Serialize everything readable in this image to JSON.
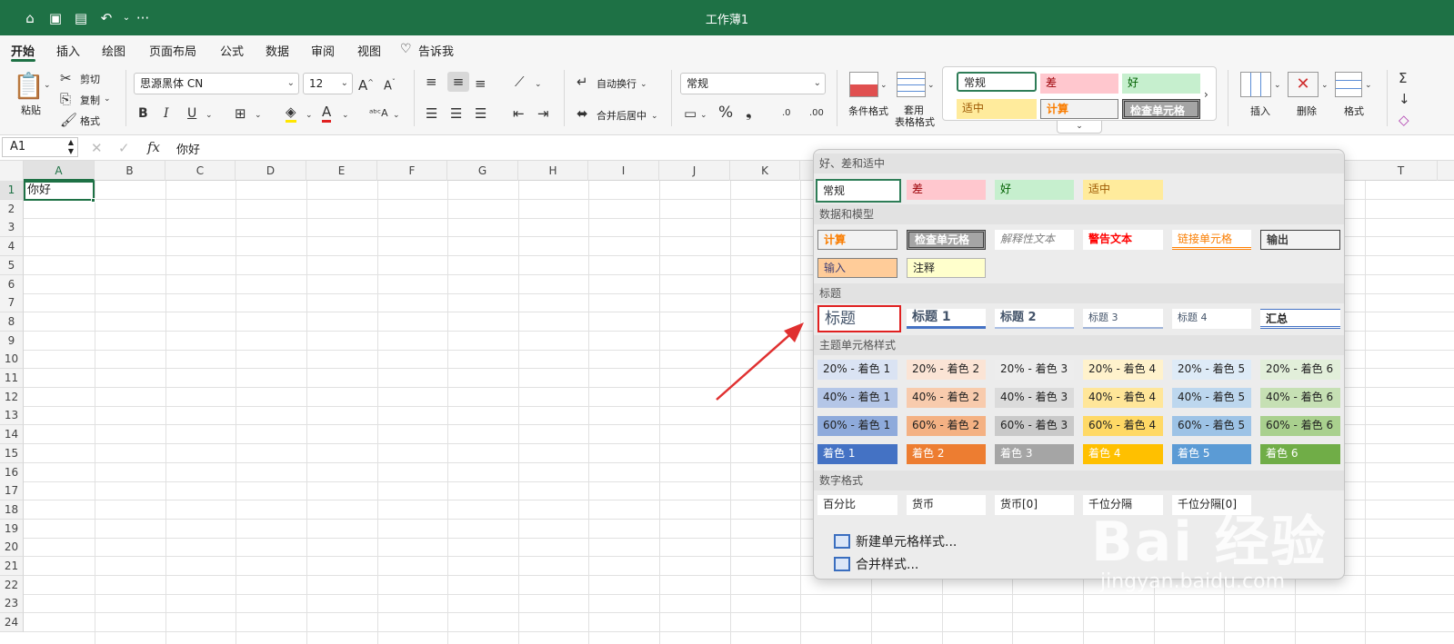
{
  "window": {
    "title": "工作薄1"
  },
  "qat": {
    "home_icon": "home-icon",
    "save_icon": "save-icon",
    "saveas_icon": "save-as-icon",
    "undo_icon": "undo-icon",
    "more": "···"
  },
  "tabs": [
    "开始",
    "插入",
    "绘图",
    "页面布局",
    "公式",
    "数据",
    "审阅",
    "视图",
    "告诉我"
  ],
  "ribbon": {
    "paste": "粘贴",
    "cut": "剪切",
    "copy": "复制",
    "format_painter": "格式",
    "font_name": "思源黑体 CN",
    "font_size": "12",
    "wrap_text": "自动换行",
    "merge_center": "合并后居中",
    "number_format": "常规",
    "cond_format": "条件格式",
    "table_format_1": "套用",
    "table_format_2": "表格格式",
    "styles": {
      "normal": "常规",
      "bad": "差",
      "good": "好",
      "neutral": "适中",
      "calc": "计算",
      "check": "检查单元格"
    },
    "insert": "插入",
    "delete": "删除",
    "format": "格式",
    "bold": "B",
    "italic": "I",
    "underline": "U",
    "percent": "%",
    "comma": "❟"
  },
  "formula": {
    "namebox": "A1",
    "fx": "fx",
    "value": "你好"
  },
  "grid": {
    "columns": [
      "A",
      "B",
      "C",
      "D",
      "E",
      "F",
      "G",
      "H",
      "I",
      "J",
      "K",
      "",
      "",
      "",
      "",
      "",
      "",
      "",
      "",
      "T"
    ],
    "rows": [
      "1",
      "2",
      "3",
      "4",
      "5",
      "6",
      "7",
      "8",
      "9",
      "10",
      "11",
      "12",
      "13",
      "14",
      "15",
      "16",
      "17",
      "18",
      "19",
      "20",
      "21",
      "22",
      "23",
      "24"
    ],
    "a1": "你好"
  },
  "dropdown": {
    "sec1": "好、差和适中",
    "sec1_items": [
      "常规",
      "差",
      "好",
      "适中"
    ],
    "sec2": "数据和模型",
    "sec2_items": [
      "计算",
      "检查单元格",
      "解释性文本",
      "警告文本",
      "链接单元格",
      "输出",
      "输入",
      "注释"
    ],
    "sec3": "标题",
    "sec3_items": [
      "标题",
      "标题 1",
      "标题 2",
      "标题 3",
      "标题 4",
      "汇总"
    ],
    "sec4": "主题单元格样式",
    "theme20": [
      "20% - 着色 1",
      "20% - 着色 2",
      "20% - 着色 3",
      "20% - 着色 4",
      "20% - 着色 5",
      "20% - 着色 6"
    ],
    "theme40": [
      "40% - 着色 1",
      "40% - 着色 2",
      "40% - 着色 3",
      "40% - 着色 4",
      "40% - 着色 5",
      "40% - 着色 6"
    ],
    "theme60": [
      "60% - 着色 1",
      "60% - 着色 2",
      "60% - 着色 3",
      "60% - 着色 4",
      "60% - 着色 5",
      "60% - 着色 6"
    ],
    "accent": [
      "着色 1",
      "着色 2",
      "着色 3",
      "着色 4",
      "着色 5",
      "着色 6"
    ],
    "sec5": "数字格式",
    "sec5_items": [
      "百分比",
      "货币",
      "货币[0]",
      "千位分隔",
      "千位分隔[0]"
    ],
    "new_style": "新建单元格样式...",
    "merge_style": "合并样式..."
  },
  "colors": {
    "excel_green": "#1e7145",
    "arrow_red": "#e03030"
  },
  "watermark": {
    "text": "Bai 经验",
    "sub": "jingyan.baidu.com"
  }
}
